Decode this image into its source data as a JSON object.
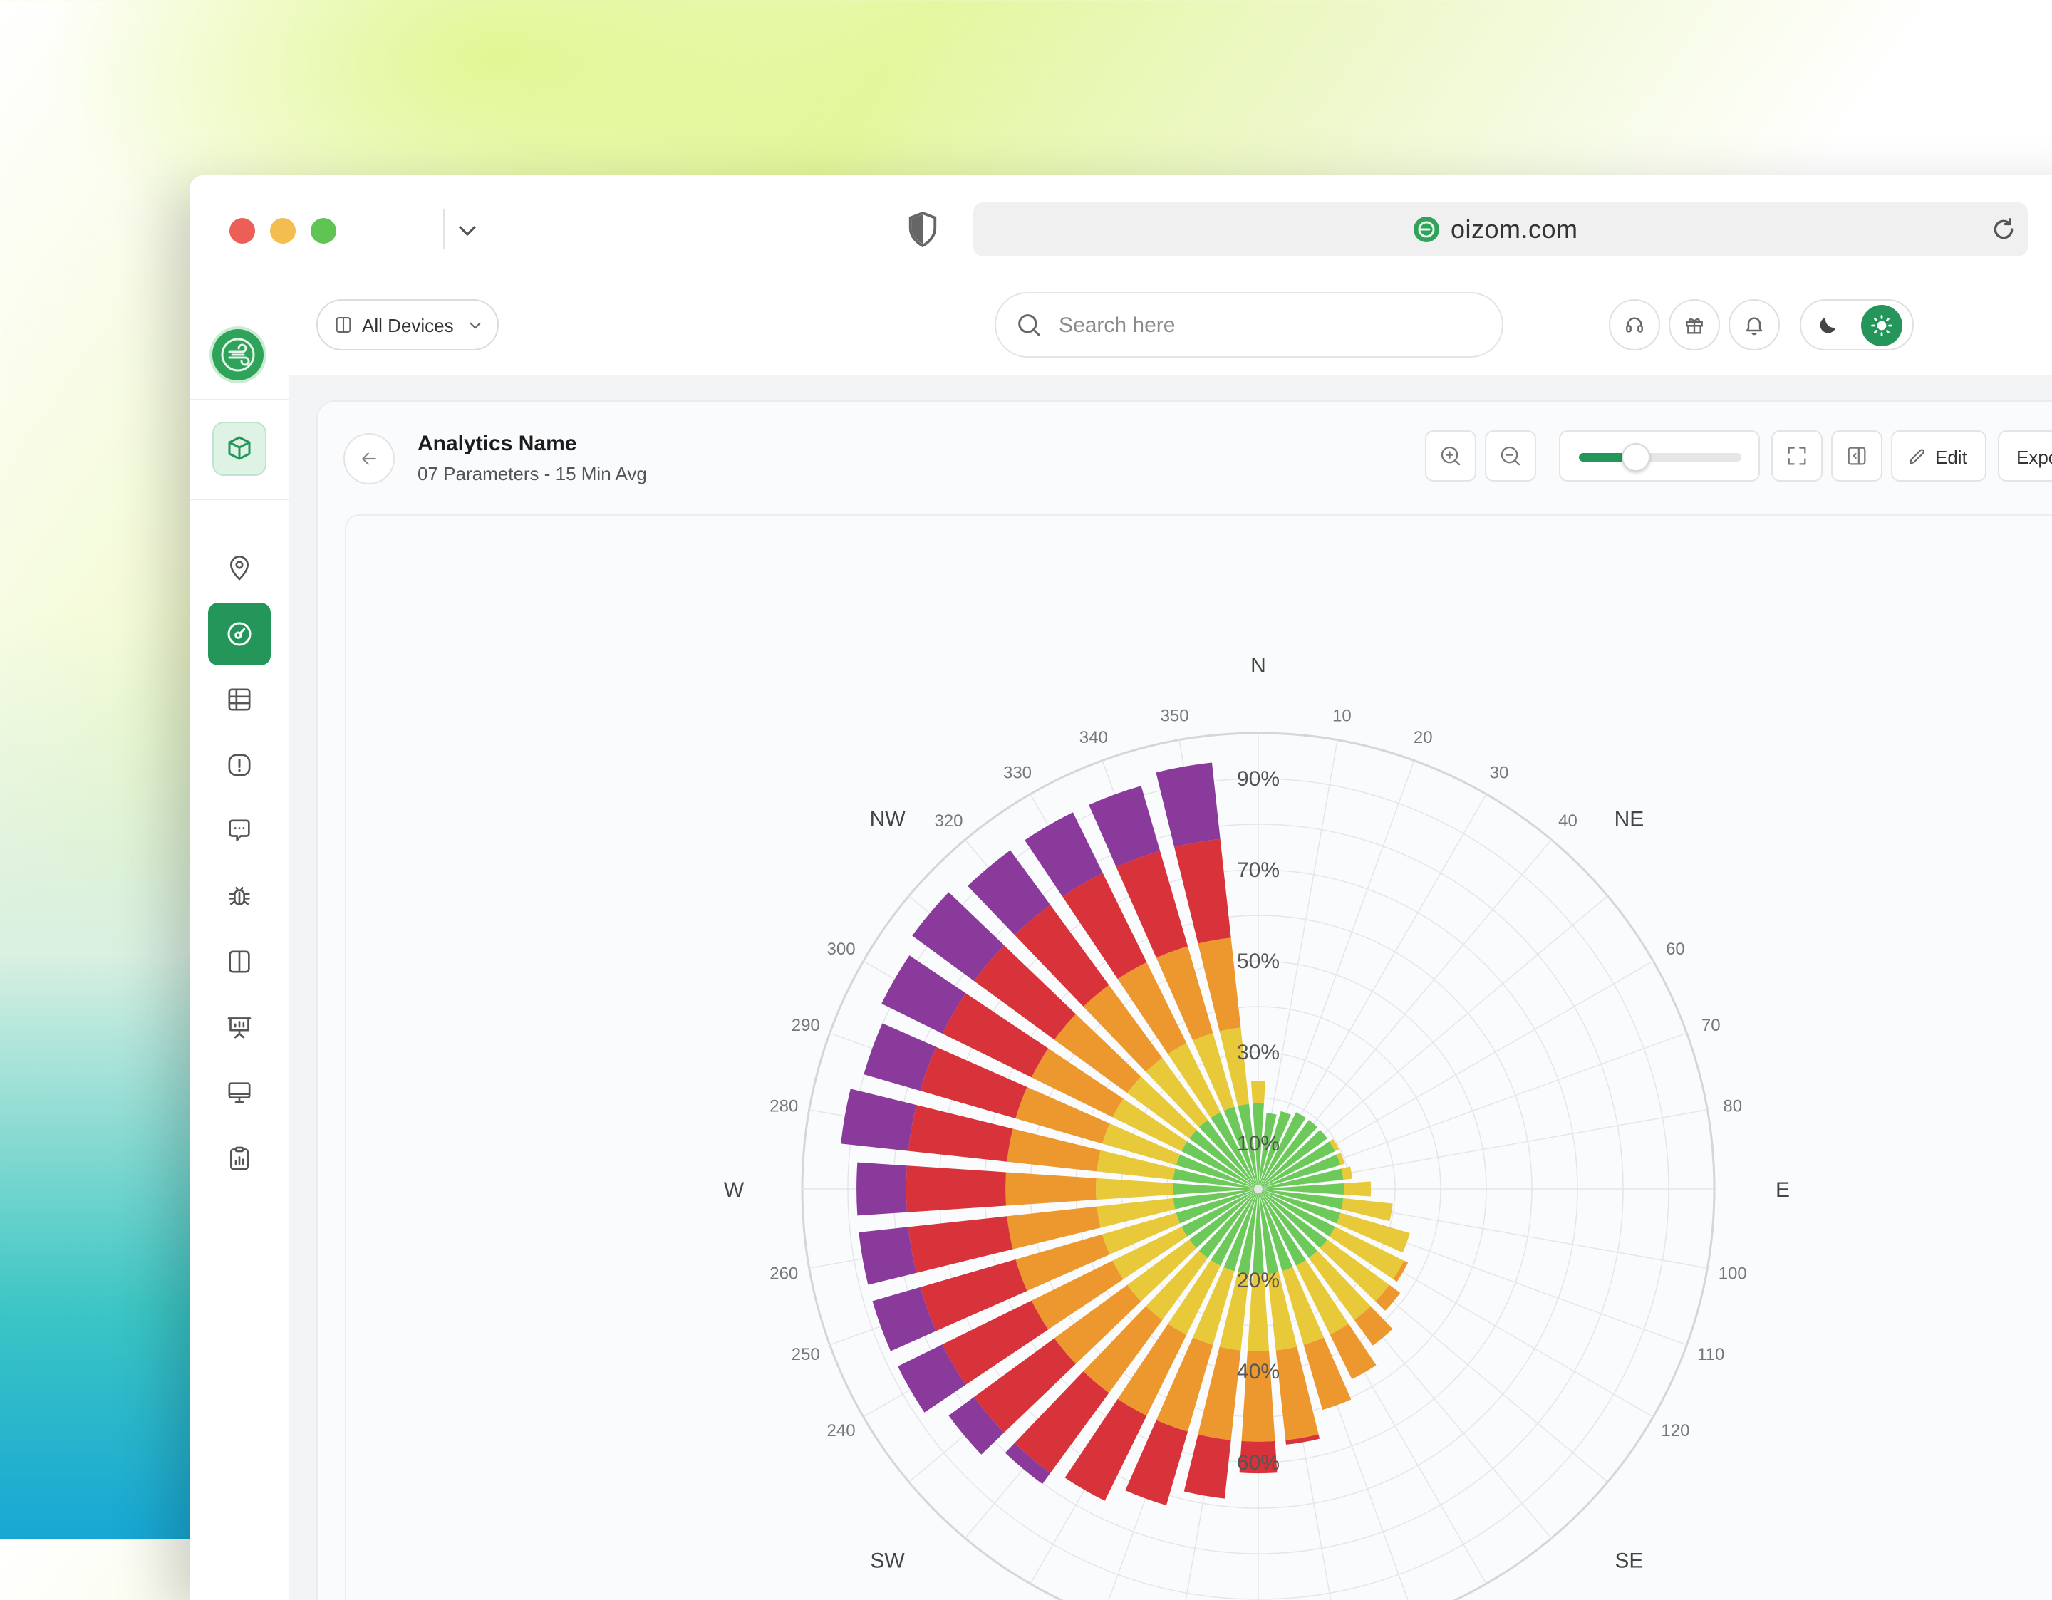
{
  "browser": {
    "url": "oizom.com"
  },
  "topbar": {
    "device_selector_label": "All Devices",
    "search_placeholder": "Search here"
  },
  "icons": {
    "traffic_lights": [
      "close",
      "minimize",
      "zoom"
    ],
    "sidebar": [
      "location-pin-icon",
      "gauge-icon",
      "table-icon",
      "alert-icon",
      "chat-icon",
      "bug-icon",
      "columns-icon",
      "presentation-icon",
      "monitor-icon",
      "clipboard-report-icon"
    ],
    "topbar_actions": [
      "headset-icon",
      "gift-icon",
      "bell-icon",
      "moon-icon",
      "sun-icon"
    ]
  },
  "colors": {
    "brand_green": "#24965a",
    "band_green": "#6cc95a",
    "band_yellow": "#e8c93a",
    "band_orange": "#ec982e",
    "band_red": "#d8333a",
    "band_purple": "#8a3a9a"
  },
  "analytics": {
    "title": "Analytics Name",
    "subtitle": "07 Parameters - 15 Min Avg",
    "zoom_level": 0.35,
    "edit_label": "Edit",
    "export_label": "Expor"
  },
  "chart_data": {
    "type": "polar-bar",
    "compass_labels": [
      "N",
      "NE",
      "E",
      "SE",
      "SW",
      "W",
      "NW"
    ],
    "angle_tick_labels": [
      "10",
      "20",
      "30",
      "40",
      "60",
      "70",
      "80",
      "100",
      "110",
      "120",
      "240",
      "250",
      "260",
      "280",
      "290",
      "300",
      "320",
      "330",
      "340",
      "350"
    ],
    "radial_tick_labels": [
      "10%",
      "30%",
      "50%",
      "70%",
      "90%",
      "20%",
      "40%",
      "60%"
    ],
    "band_colors": [
      "#6cc95a",
      "#e8c93a",
      "#ec982e",
      "#d8333a",
      "#8a3a9a"
    ],
    "band_upper_limits": [
      18,
      35,
      55,
      77,
      100
    ],
    "directions": [
      0,
      10,
      20,
      30,
      40,
      50,
      60,
      70,
      80,
      90,
      100,
      110,
      120,
      130,
      140,
      150,
      160,
      170,
      180,
      190,
      200,
      210,
      220,
      230,
      240,
      250,
      260,
      270,
      280,
      290,
      300,
      310,
      320,
      330,
      340,
      350
    ],
    "values": [
      23,
      16,
      17,
      18,
      18,
      18,
      19,
      19,
      20,
      24,
      29,
      34,
      36,
      38,
      42,
      46,
      50,
      56,
      62,
      68,
      72,
      76,
      80,
      84,
      88,
      88,
      88,
      88,
      92,
      90,
      92,
      94,
      92,
      92,
      92,
      94
    ]
  }
}
